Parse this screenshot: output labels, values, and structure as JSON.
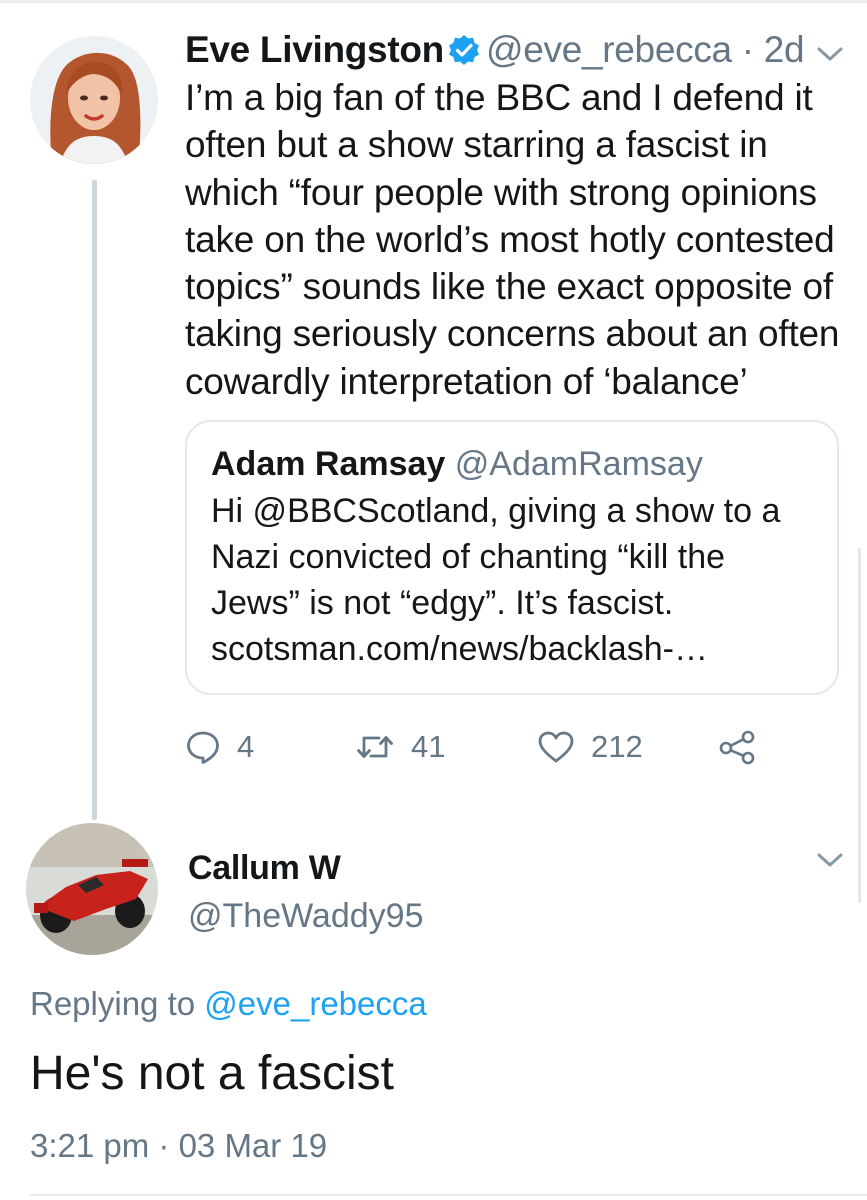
{
  "tweet": {
    "author_name": "Eve Livingston",
    "author_handle": "@eve_rebecca",
    "time_sep": " · ",
    "age": "2d",
    "text": "I’m a big fan of the BBC and I defend it often but a show starring a fascist in which “four people with strong opinions take on the world’s most hotly contested topics” sounds like the exact opposite of taking seriously concerns about an often cowardly interpretation of ‘balance’",
    "quoted": {
      "author_name": "Adam Ramsay",
      "author_handle": "@AdamRamsay",
      "text": "Hi @BBCScotland, giving a show to a Nazi convicted of chanting “kill the Jews” is not “edgy”. It’s fascist. scotsman.com/news/backlash-…"
    },
    "actions": {
      "replies": "4",
      "retweets": "41",
      "likes": "212"
    }
  },
  "reply": {
    "author_name": "Callum W",
    "author_handle": "@TheWaddy95",
    "replying_prefix": "Replying to ",
    "replying_to": "@eve_rebecca",
    "text": "He's not a fascist",
    "timestamp": "3:21 pm · 03 Mar 19"
  },
  "icons": {
    "verified": "verified-badge-icon",
    "menu": "chevron-down-icon",
    "reply": "reply-bubble-icon",
    "retweet": "retweet-icon",
    "like": "heart-icon",
    "share": "share-icon"
  },
  "colors": {
    "text": "#14171a",
    "muted": "#657786",
    "link": "#1da1f2",
    "border": "#e1e8ed",
    "thread_line": "#ccd6dd"
  }
}
